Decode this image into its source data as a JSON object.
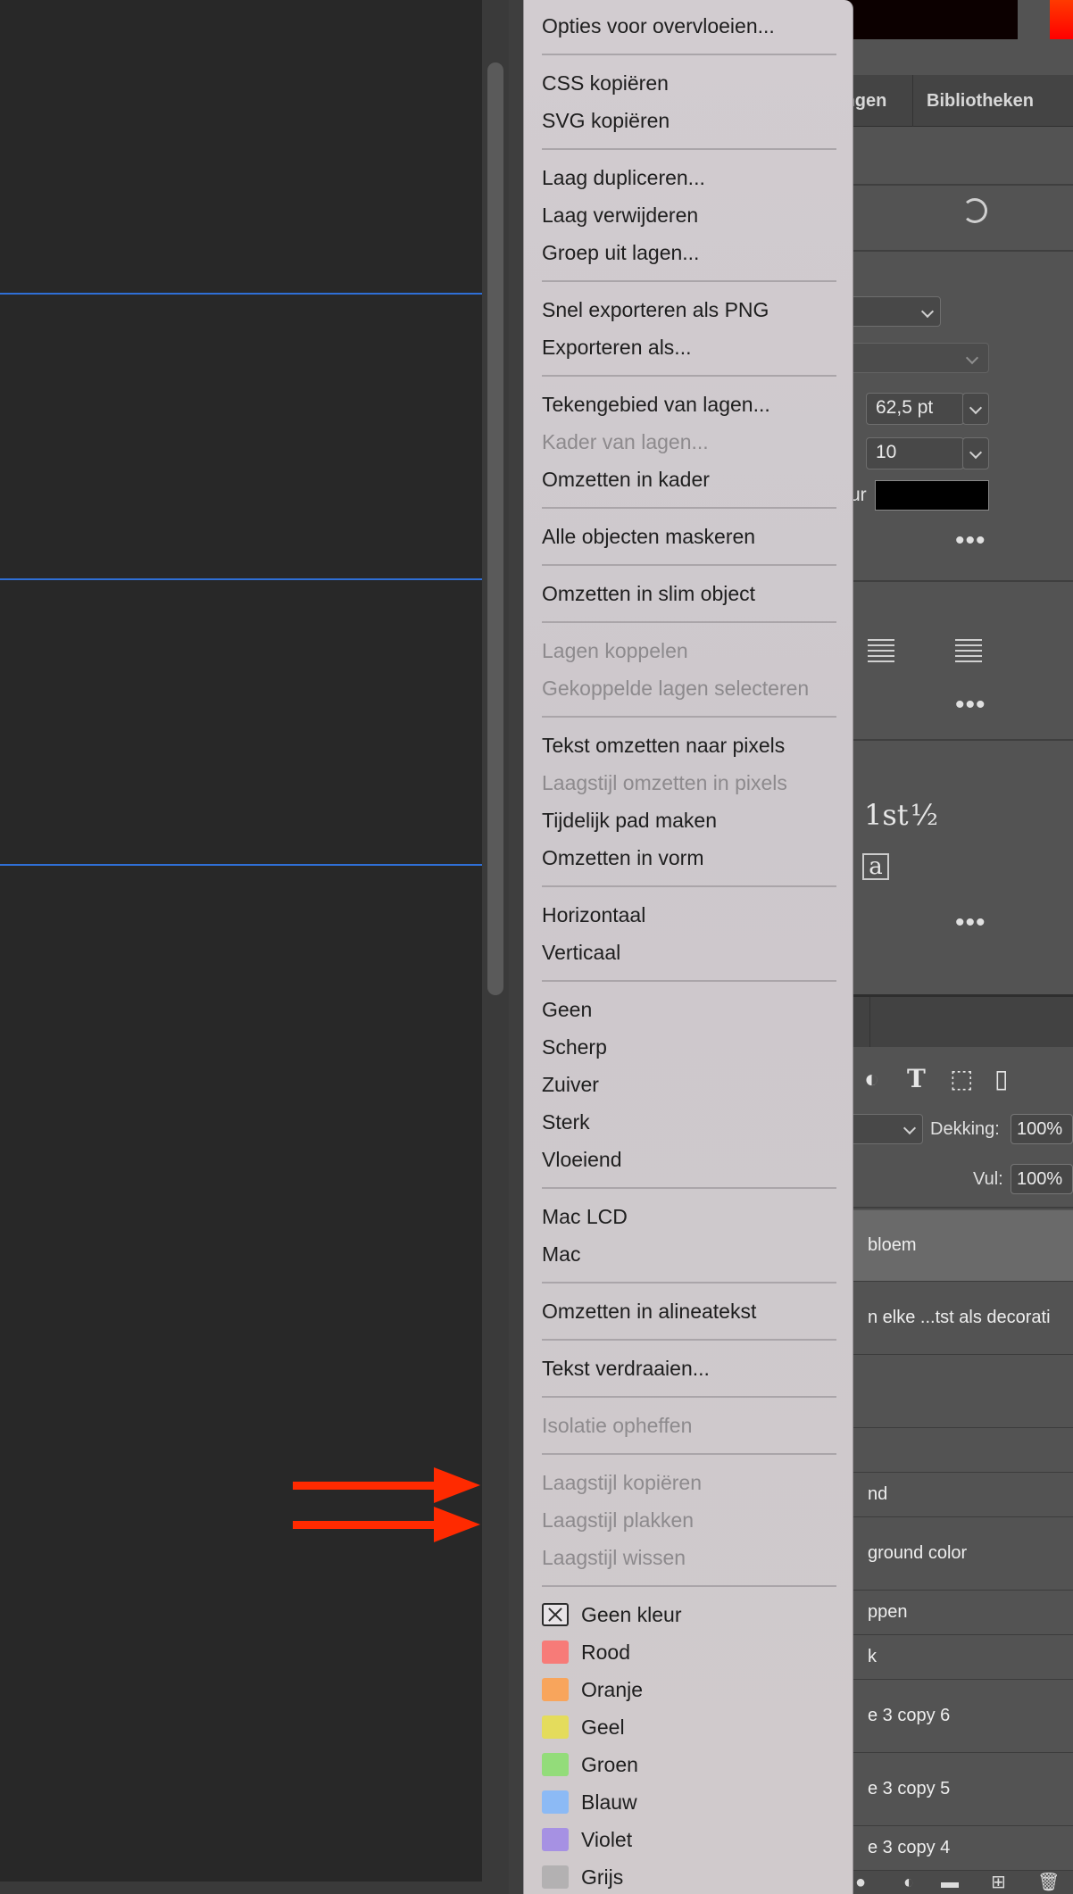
{
  "menu": {
    "items": [
      {
        "type": "item",
        "label": "Opties voor overvloeien...",
        "enabled": true
      },
      {
        "type": "separator"
      },
      {
        "type": "item",
        "label": "CSS kopiëren",
        "enabled": true
      },
      {
        "type": "item",
        "label": "SVG kopiëren",
        "enabled": true
      },
      {
        "type": "separator"
      },
      {
        "type": "item",
        "label": "Laag dupliceren...",
        "enabled": true
      },
      {
        "type": "item",
        "label": "Laag verwijderen",
        "enabled": true
      },
      {
        "type": "item",
        "label": "Groep uit lagen...",
        "enabled": true
      },
      {
        "type": "separator"
      },
      {
        "type": "item",
        "label": "Snel exporteren als PNG",
        "enabled": true
      },
      {
        "type": "item",
        "label": "Exporteren als...",
        "enabled": true
      },
      {
        "type": "separator"
      },
      {
        "type": "item",
        "label": "Tekengebied van lagen...",
        "enabled": true
      },
      {
        "type": "item",
        "label": "Kader van lagen...",
        "enabled": false
      },
      {
        "type": "item",
        "label": "Omzetten in kader",
        "enabled": true
      },
      {
        "type": "separator"
      },
      {
        "type": "item",
        "label": "Alle objecten maskeren",
        "enabled": true
      },
      {
        "type": "separator"
      },
      {
        "type": "item",
        "label": "Omzetten in slim object",
        "enabled": true
      },
      {
        "type": "separator"
      },
      {
        "type": "item",
        "label": "Lagen koppelen",
        "enabled": false
      },
      {
        "type": "item",
        "label": "Gekoppelde lagen selecteren",
        "enabled": false
      },
      {
        "type": "separator"
      },
      {
        "type": "item",
        "label": "Tekst omzetten naar pixels",
        "enabled": true
      },
      {
        "type": "item",
        "label": "Laagstijl omzetten in pixels",
        "enabled": false
      },
      {
        "type": "item",
        "label": "Tijdelijk pad maken",
        "enabled": true
      },
      {
        "type": "item",
        "label": "Omzetten in vorm",
        "enabled": true
      },
      {
        "type": "separator"
      },
      {
        "type": "item",
        "label": "Horizontaal",
        "enabled": true
      },
      {
        "type": "item",
        "label": "Verticaal",
        "enabled": true
      },
      {
        "type": "separator"
      },
      {
        "type": "item",
        "label": "Geen",
        "enabled": true
      },
      {
        "type": "item",
        "label": "Scherp",
        "enabled": true
      },
      {
        "type": "item",
        "label": "Zuiver",
        "enabled": true
      },
      {
        "type": "item",
        "label": "Sterk",
        "enabled": true
      },
      {
        "type": "item",
        "label": "Vloeiend",
        "enabled": true
      },
      {
        "type": "separator"
      },
      {
        "type": "item",
        "label": "Mac LCD",
        "enabled": true
      },
      {
        "type": "item",
        "label": "Mac",
        "enabled": true
      },
      {
        "type": "separator"
      },
      {
        "type": "item",
        "label": "Omzetten in alineatekst",
        "enabled": true
      },
      {
        "type": "separator"
      },
      {
        "type": "item",
        "label": "Tekst verdraaien...",
        "enabled": true
      },
      {
        "type": "separator"
      },
      {
        "type": "item",
        "label": "Isolatie opheffen",
        "enabled": false
      },
      {
        "type": "separator"
      },
      {
        "type": "item",
        "label": "Laagstijl kopiëren",
        "enabled": false
      },
      {
        "type": "item",
        "label": "Laagstijl plakken",
        "enabled": false
      },
      {
        "type": "item",
        "label": "Laagstijl wissen",
        "enabled": false
      },
      {
        "type": "separator"
      },
      {
        "type": "color",
        "label": "Geen kleur",
        "color": "none"
      },
      {
        "type": "color",
        "label": "Rood",
        "color": "#f77b78"
      },
      {
        "type": "color",
        "label": "Oranje",
        "color": "#f8a55c"
      },
      {
        "type": "color",
        "label": "Geel",
        "color": "#e4dc5c"
      },
      {
        "type": "color",
        "label": "Groen",
        "color": "#93dc7a"
      },
      {
        "type": "color",
        "label": "Blauw",
        "color": "#8cbaf5"
      },
      {
        "type": "color",
        "label": "Violet",
        "color": "#a691e3"
      },
      {
        "type": "color",
        "label": "Grijs",
        "color": "#b3b1b2"
      }
    ]
  },
  "panel": {
    "tabs": [
      "ingen",
      "Bibliotheken"
    ],
    "font_size_value": "62,5 pt",
    "leading_value": "10",
    "color_label_fragment": "ur",
    "glyph_ordinal": "1st",
    "glyph_fraction": "½",
    "opacity_label": "Dekking:",
    "opacity_value": "100%",
    "fill_label": "Vul:",
    "fill_value": "100%",
    "layers": [
      "bloem",
      "n elke ...tst als decorati",
      "",
      "nd",
      "ground color",
      "ppen",
      "k",
      "e 3 copy 6",
      "e 3 copy 5",
      "e 3 copy 4"
    ]
  },
  "annotations": {
    "arrow_color": "#ff2a00",
    "guide_color": "#2f6fd6"
  }
}
